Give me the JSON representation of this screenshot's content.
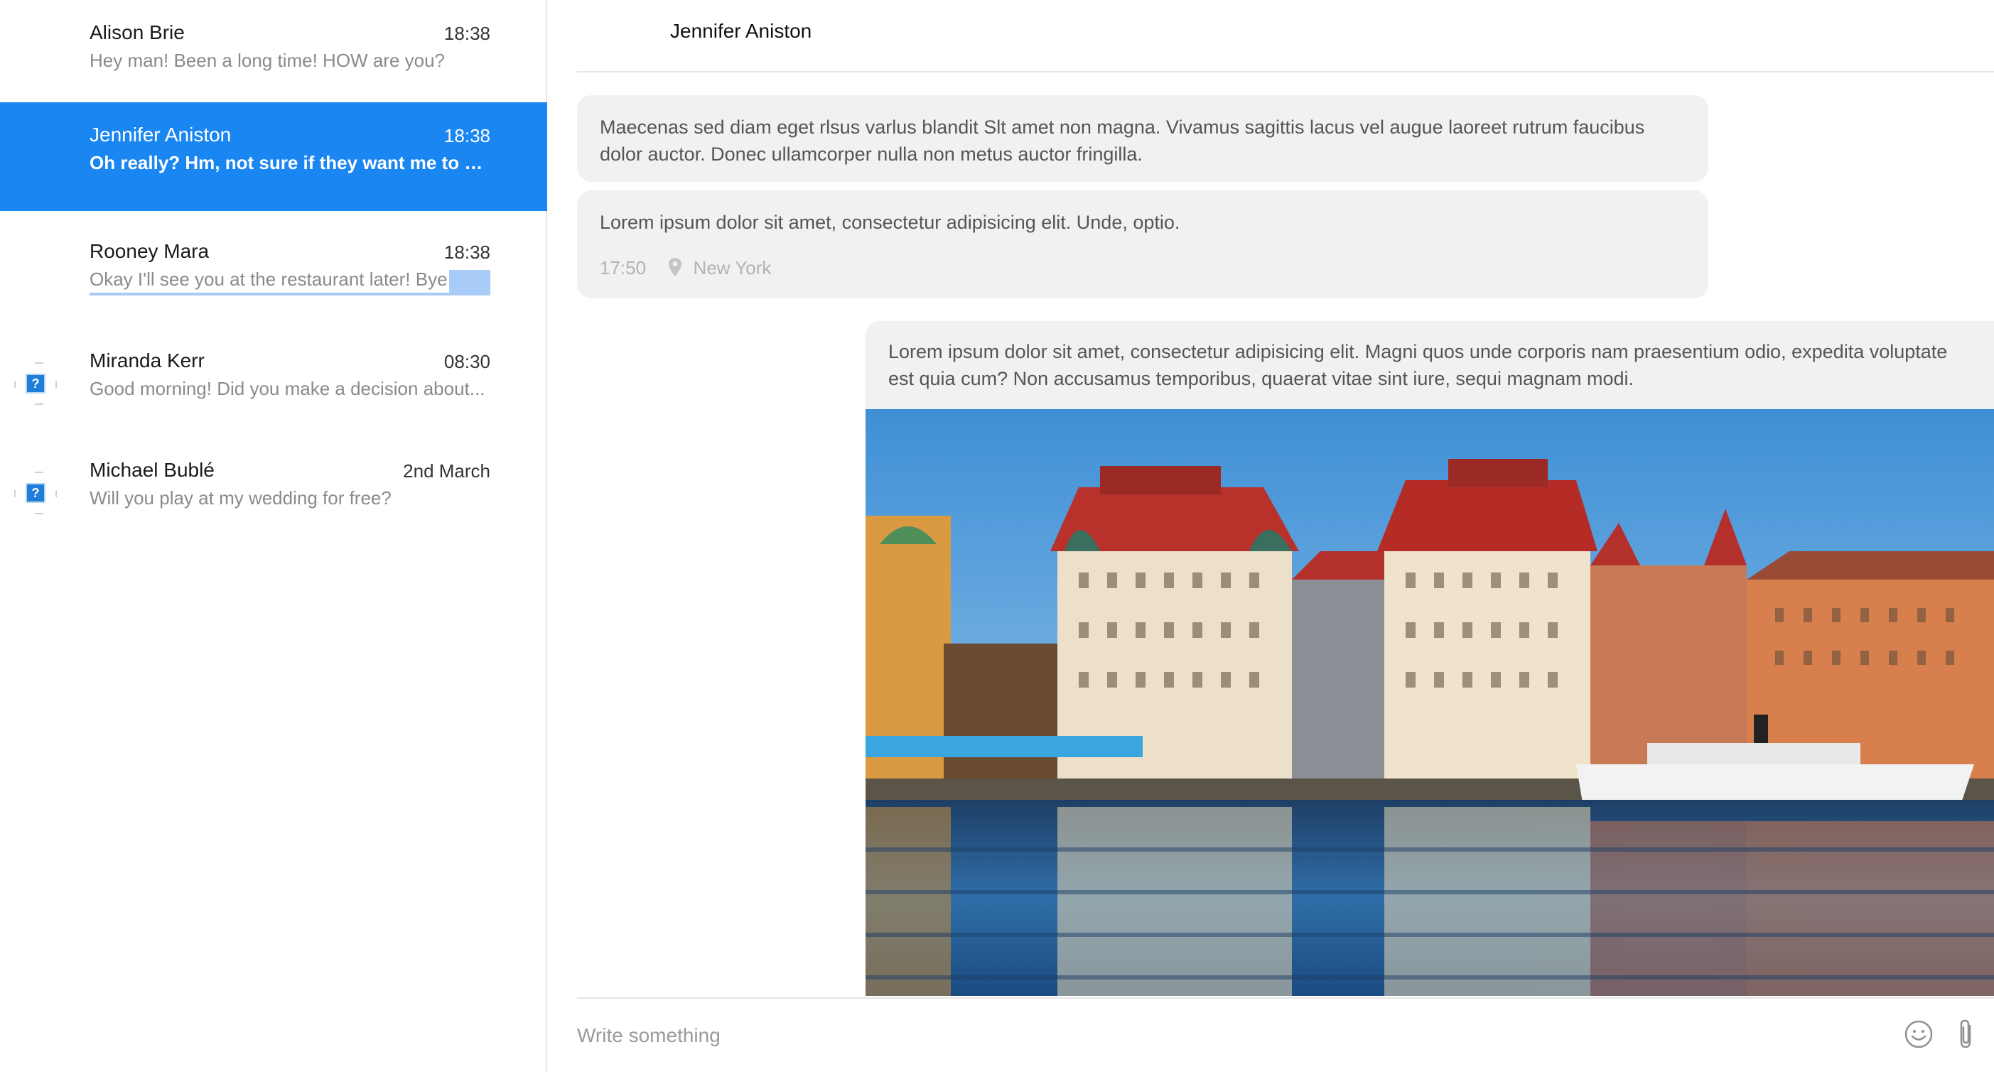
{
  "conversations": [
    {
      "name": "Alison Brie",
      "time": "18:38",
      "preview": "Hey man! Been a long time! HOW are you?"
    },
    {
      "name": "Jennifer Aniston",
      "time": "18:38",
      "preview": "Oh really? Hm, not sure if they want me to be l..."
    },
    {
      "name": "Rooney Mara",
      "time": "18:38",
      "preview": "Okay I'll see you at the restaurant later! Bye"
    },
    {
      "name": "Miranda Kerr",
      "time": "08:30",
      "preview": "Good morning! Did you make a decision about..."
    },
    {
      "name": "Michael Bublé",
      "time": "2nd March",
      "preview": "Will you play at my wedding for free?"
    }
  ],
  "chat": {
    "title": "Jennifer Aniston",
    "messages": [
      {
        "text": "Maecenas sed diam eget rlsus varlus blandit Slt amet non magna. Vivamus sagittis lacus vel augue laoreet rutrum faucibus dolor auctor. Donec ullamcorper nulla non metus auctor fringilla."
      },
      {
        "text": "Lorem ipsum dolor sit amet, consectetur adipisicing elit. Unde, optio.",
        "time": "17:50",
        "location": "New York"
      },
      {
        "text": "Lorem ipsum dolor sit amet, consectetur adipisicing elit. Magni quos unde corporis nam praesentium odio, expedita voluptate est quia cum? Non accusamus temporibus, quaerat vitae sint iure, sequi magnam modi."
      }
    ]
  },
  "composer": {
    "placeholder": "Write something"
  },
  "icons": {
    "location": "map-pin-icon",
    "emoji": "smiley-icon",
    "attach": "paperclip-icon",
    "avatar_placeholder": "broken-image-icon"
  },
  "colors": {
    "accent": "#1a86f2",
    "bubble": "#f1f1f1",
    "selection": "#a9cbf7"
  }
}
